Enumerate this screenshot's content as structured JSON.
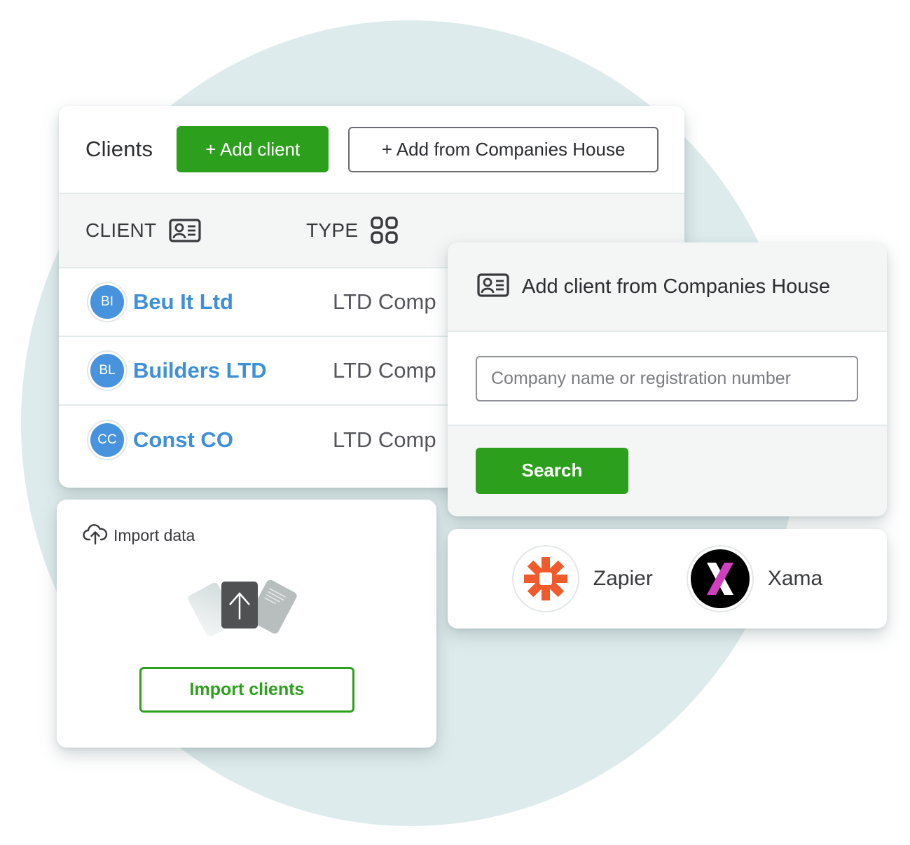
{
  "clients_panel": {
    "title": "Clients",
    "add_client_label": "+ Add client",
    "add_from_ch_label": "+ Add from Companies House",
    "columns": [
      {
        "label": "CLIENT",
        "icon": "id-card-icon"
      },
      {
        "label": "TYPE",
        "icon": "grid-icon"
      }
    ],
    "rows": [
      {
        "initials": "BI",
        "name": "Beu It Ltd",
        "type": "LTD Comp"
      },
      {
        "initials": "BL",
        "name": "Builders LTD",
        "type": "LTD Comp"
      },
      {
        "initials": "CC",
        "name": "Const CO",
        "type": "LTD Comp"
      }
    ]
  },
  "companies_house_panel": {
    "title": "Add client from Companies House",
    "icon": "id-card-icon",
    "search_placeholder": "Company name or registration number",
    "search_value": "",
    "search_button_label": "Search"
  },
  "integrations": [
    {
      "name": "Zapier",
      "icon": "zapier-logo-icon"
    },
    {
      "name": "Xama",
      "icon": "xama-logo-icon"
    }
  ],
  "import_panel": {
    "title": "Import data",
    "icon": "cloud-upload-icon",
    "button_label": "Import clients"
  },
  "colors": {
    "primary_green": "#2ca01c",
    "link_blue": "#3d8fd9",
    "avatar_blue": "#4793dd",
    "background_circle": "#deebec",
    "zapier_orange": "#ef5b2d",
    "xama_magenta": "#d13fc1"
  }
}
